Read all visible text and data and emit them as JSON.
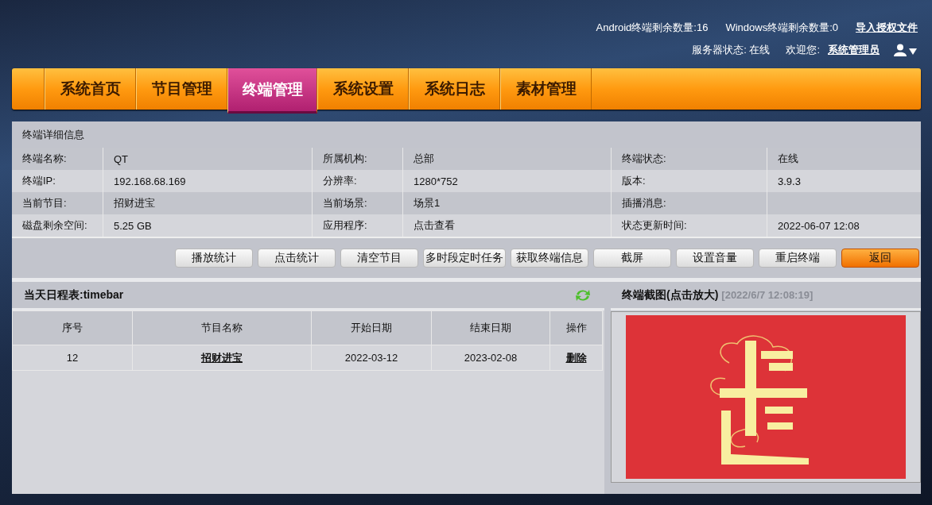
{
  "header": {
    "android_count": "Android终端剩余数量:16",
    "windows_count": "Windows终端剩余数量:0",
    "import_link": "导入授权文件",
    "server_status": "服务器状态: 在线",
    "welcome": "欢迎您:",
    "user_link": "系统管理员"
  },
  "nav": [
    {
      "label": "系统首页",
      "selected": false
    },
    {
      "label": "节目管理",
      "selected": false
    },
    {
      "label": "终端管理",
      "selected": true
    },
    {
      "label": "系统设置",
      "selected": false
    },
    {
      "label": "系统日志",
      "selected": false
    },
    {
      "label": "素材管理",
      "selected": false
    }
  ],
  "details": {
    "title": "终端详细信息",
    "rows": [
      [
        {
          "label": "终端名称:",
          "value": "QT"
        },
        {
          "label": "所属机构:",
          "value": "总部"
        },
        {
          "label": "终端状态:",
          "value": "在线"
        }
      ],
      [
        {
          "label": "终端IP:",
          "value": "192.168.68.169"
        },
        {
          "label": "分辨率:",
          "value": "1280*752"
        },
        {
          "label": "版本:",
          "value": "3.9.3"
        }
      ],
      [
        {
          "label": "当前节目:",
          "value": "招财进宝"
        },
        {
          "label": "当前场景:",
          "value": "场景1"
        },
        {
          "label": "插播消息:"
        }
      ],
      [
        {
          "label": "磁盘剩余空间:",
          "value": "5.25 GB"
        },
        {
          "label": "应用程序:",
          "value": "点击查看"
        },
        {
          "label": "状态更新时间:",
          "value": "2022-06-07 12:08"
        }
      ]
    ]
  },
  "actions": [
    {
      "label": "播放统计",
      "primary": false
    },
    {
      "label": "点击统计",
      "primary": false
    },
    {
      "label": "清空节目",
      "primary": false
    },
    {
      "label": "多时段定时任务",
      "primary": false
    },
    {
      "label": "获取终端信息",
      "primary": false
    },
    {
      "label": "截屏",
      "primary": false
    },
    {
      "label": "设置音量",
      "primary": false
    },
    {
      "label": "重启终端",
      "primary": false
    },
    {
      "label": "返回",
      "primary": true
    }
  ],
  "schedule": {
    "title": "当天日程表:timebar",
    "columns": [
      "序号",
      "节目名称",
      "开始日期",
      "结束日期",
      "操作"
    ],
    "rows": [
      {
        "no": "12",
        "name": "招财进宝",
        "start": "2022-03-12",
        "end": "2023-02-08",
        "action": "删除"
      }
    ]
  },
  "screenshot": {
    "title": "终端截图(点击放大)",
    "timestamp": "[2022/6/7 12:08:19]"
  }
}
